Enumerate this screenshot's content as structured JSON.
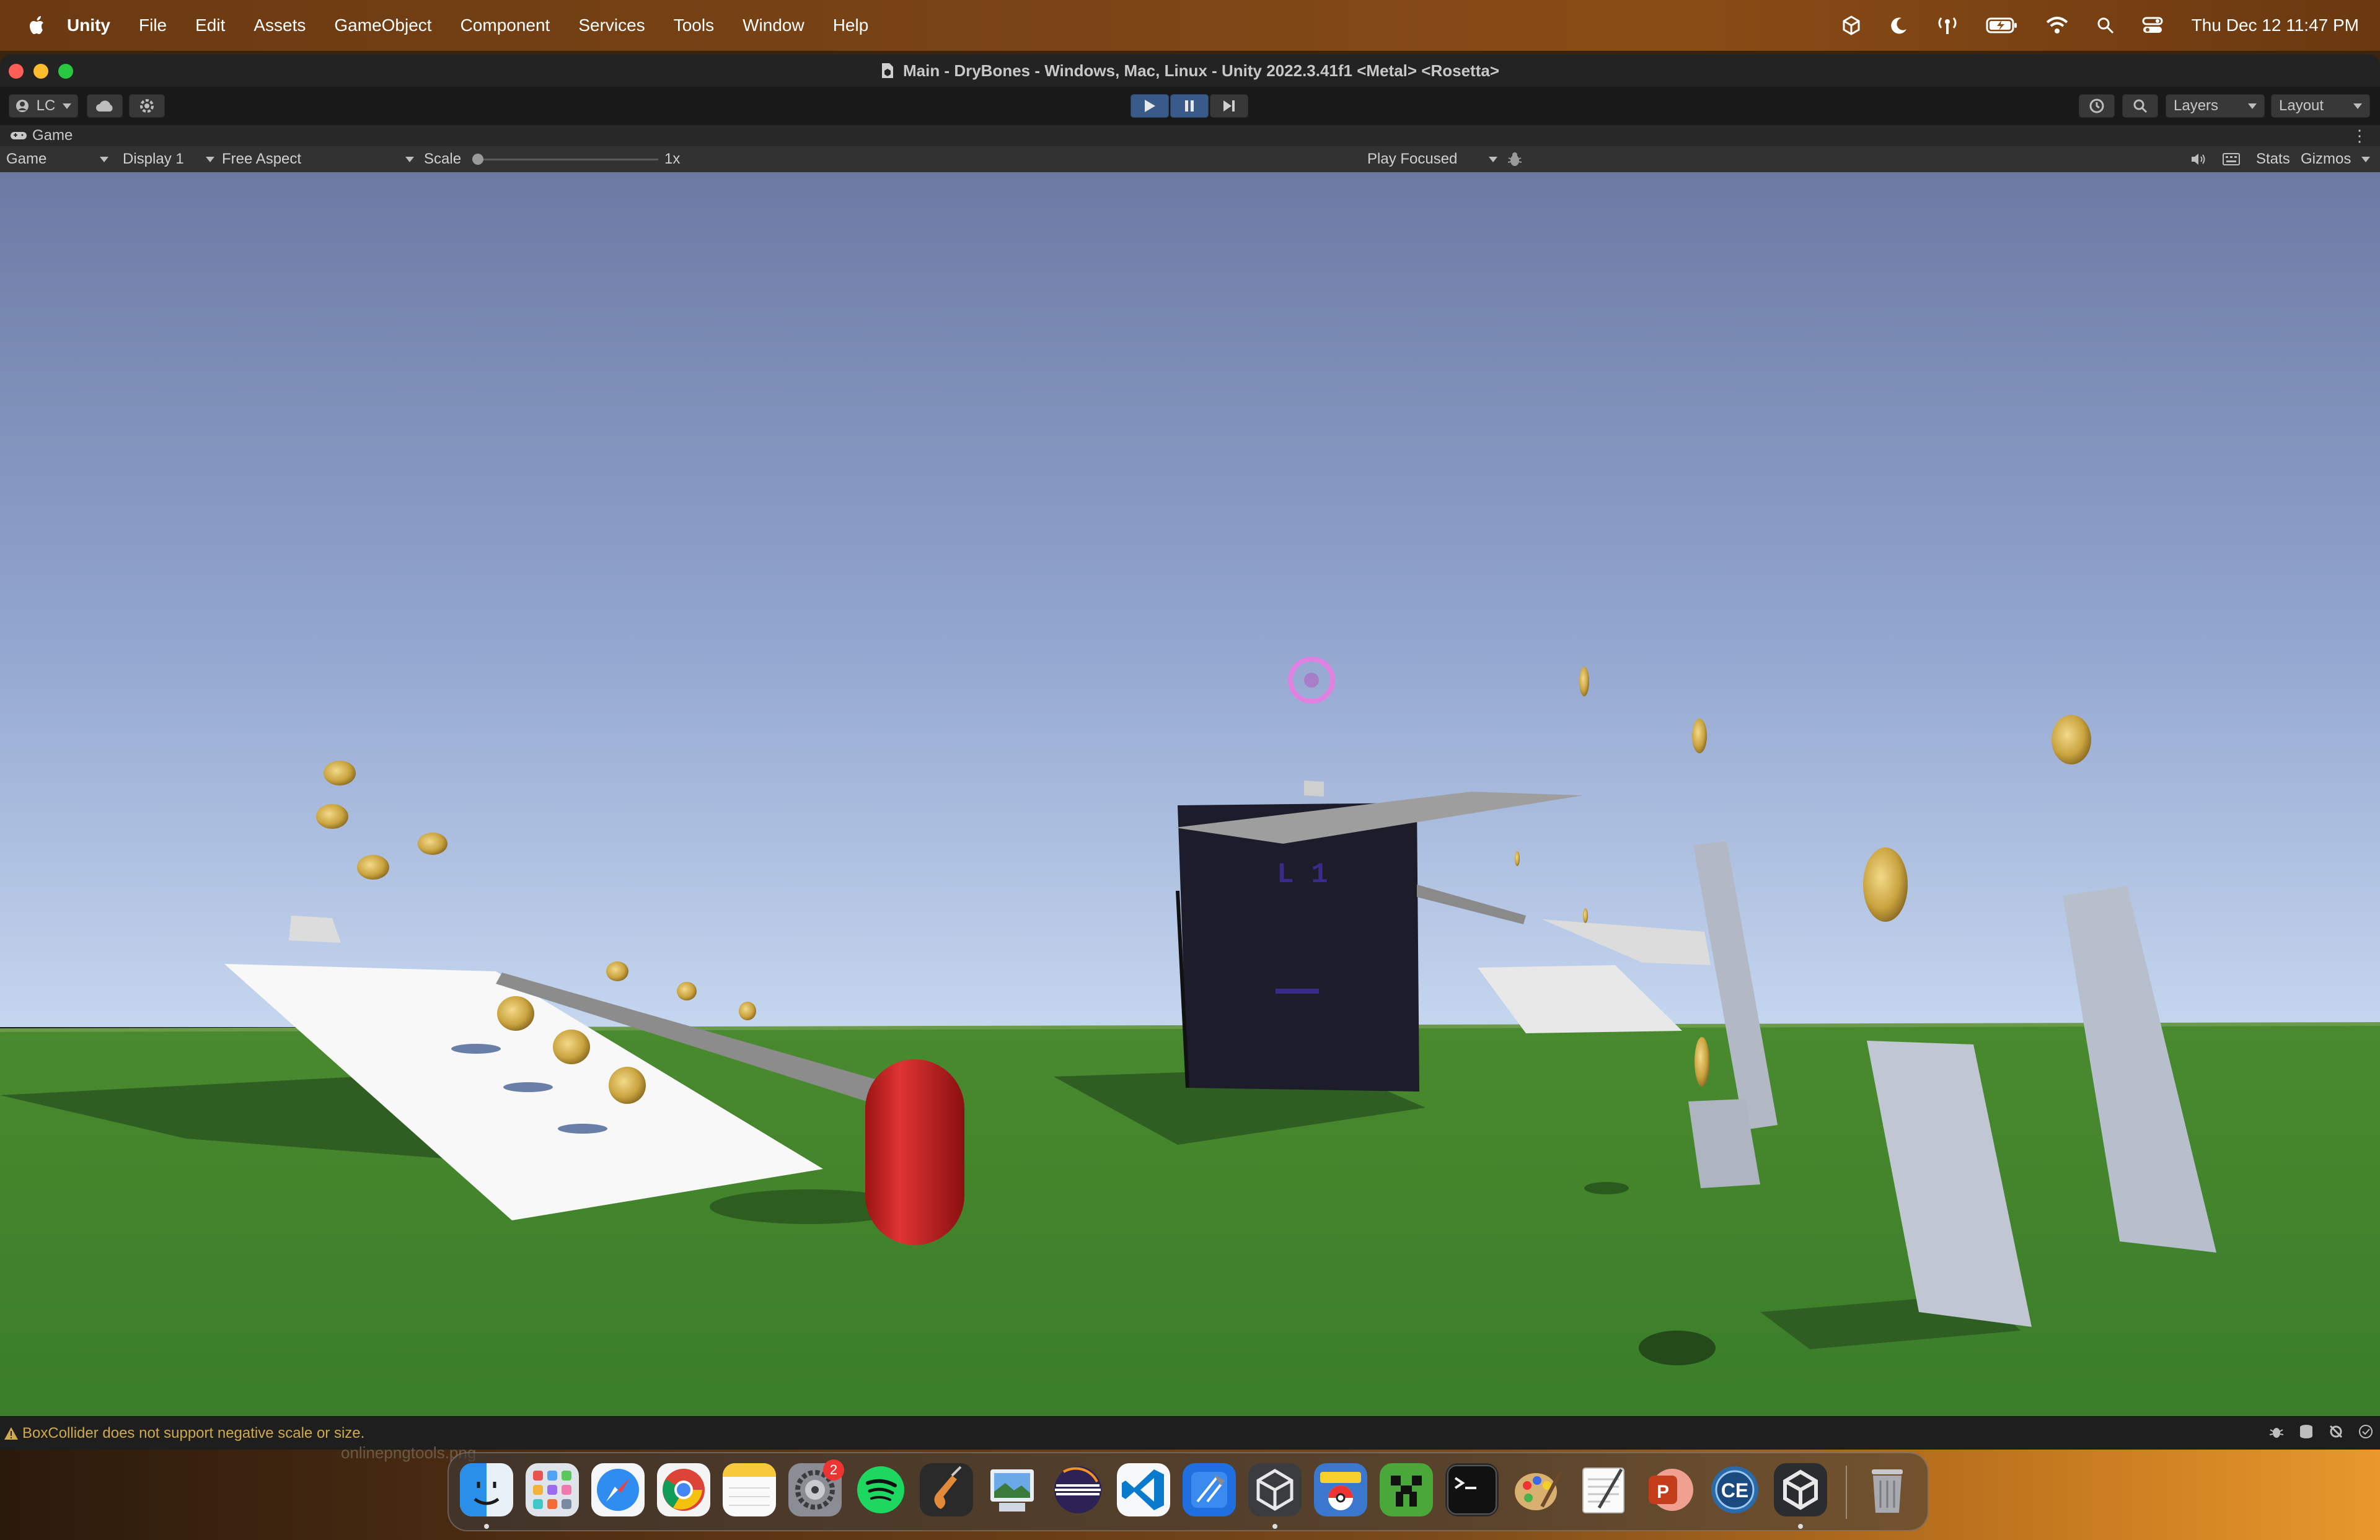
{
  "menubar": {
    "app_name": "Unity",
    "items": [
      "File",
      "Edit",
      "Assets",
      "GameObject",
      "Component",
      "Services",
      "Tools",
      "Window",
      "Help"
    ],
    "clock": "Thu Dec 12  11:47 PM"
  },
  "window": {
    "title": "Main - DryBones - Windows, Mac, Linux - Unity 2022.3.41f1 <Metal> <Rosetta>"
  },
  "toolbar": {
    "account": "LC",
    "layers": "Layers",
    "layout": "Layout"
  },
  "game_tab": {
    "label": "Game"
  },
  "game_controls": {
    "view_mode": "Game",
    "display": "Display 1",
    "aspect": "Free Aspect",
    "scale_label": "Scale",
    "scale_value": "1x",
    "play_mode": "Play Focused",
    "stats": "Stats",
    "gizmos": "Gizmos"
  },
  "viewport": {
    "sign_text": "L 1"
  },
  "statusbar": {
    "message": "BoxCollider does not support negative scale or size."
  },
  "desktop": {
    "ghost_text": "onlinepngtools.png"
  },
  "dock": {
    "apps": [
      {
        "name": "finder-icon",
        "running": true
      },
      {
        "name": "launchpad-icon",
        "running": false
      },
      {
        "name": "safari-icon",
        "running": false
      },
      {
        "name": "chrome-icon",
        "running": false
      },
      {
        "name": "notes-icon",
        "running": false
      },
      {
        "name": "system-settings-icon",
        "running": false,
        "badge": "2"
      },
      {
        "name": "spotify-icon",
        "running": false
      },
      {
        "name": "garageband-icon",
        "running": false
      },
      {
        "name": "preview-icon",
        "running": false
      },
      {
        "name": "eclipse-icon",
        "running": false
      },
      {
        "name": "vscode-icon",
        "running": false
      },
      {
        "name": "xcode-icon",
        "running": false
      },
      {
        "name": "unity-hub-icon",
        "running": true
      },
      {
        "name": "pokemon-tcg-icon",
        "running": false
      },
      {
        "name": "minecraft-icon",
        "running": false
      },
      {
        "name": "terminal-icon",
        "running": false
      },
      {
        "name": "paint-icon",
        "running": false
      },
      {
        "name": "textedit-icon",
        "running": false
      },
      {
        "name": "powerpoint-icon",
        "running": false
      },
      {
        "name": "cheat-engine-icon",
        "running": false
      },
      {
        "name": "unity-icon",
        "running": true
      },
      {
        "name": "trash-icon",
        "running": false
      }
    ]
  }
}
